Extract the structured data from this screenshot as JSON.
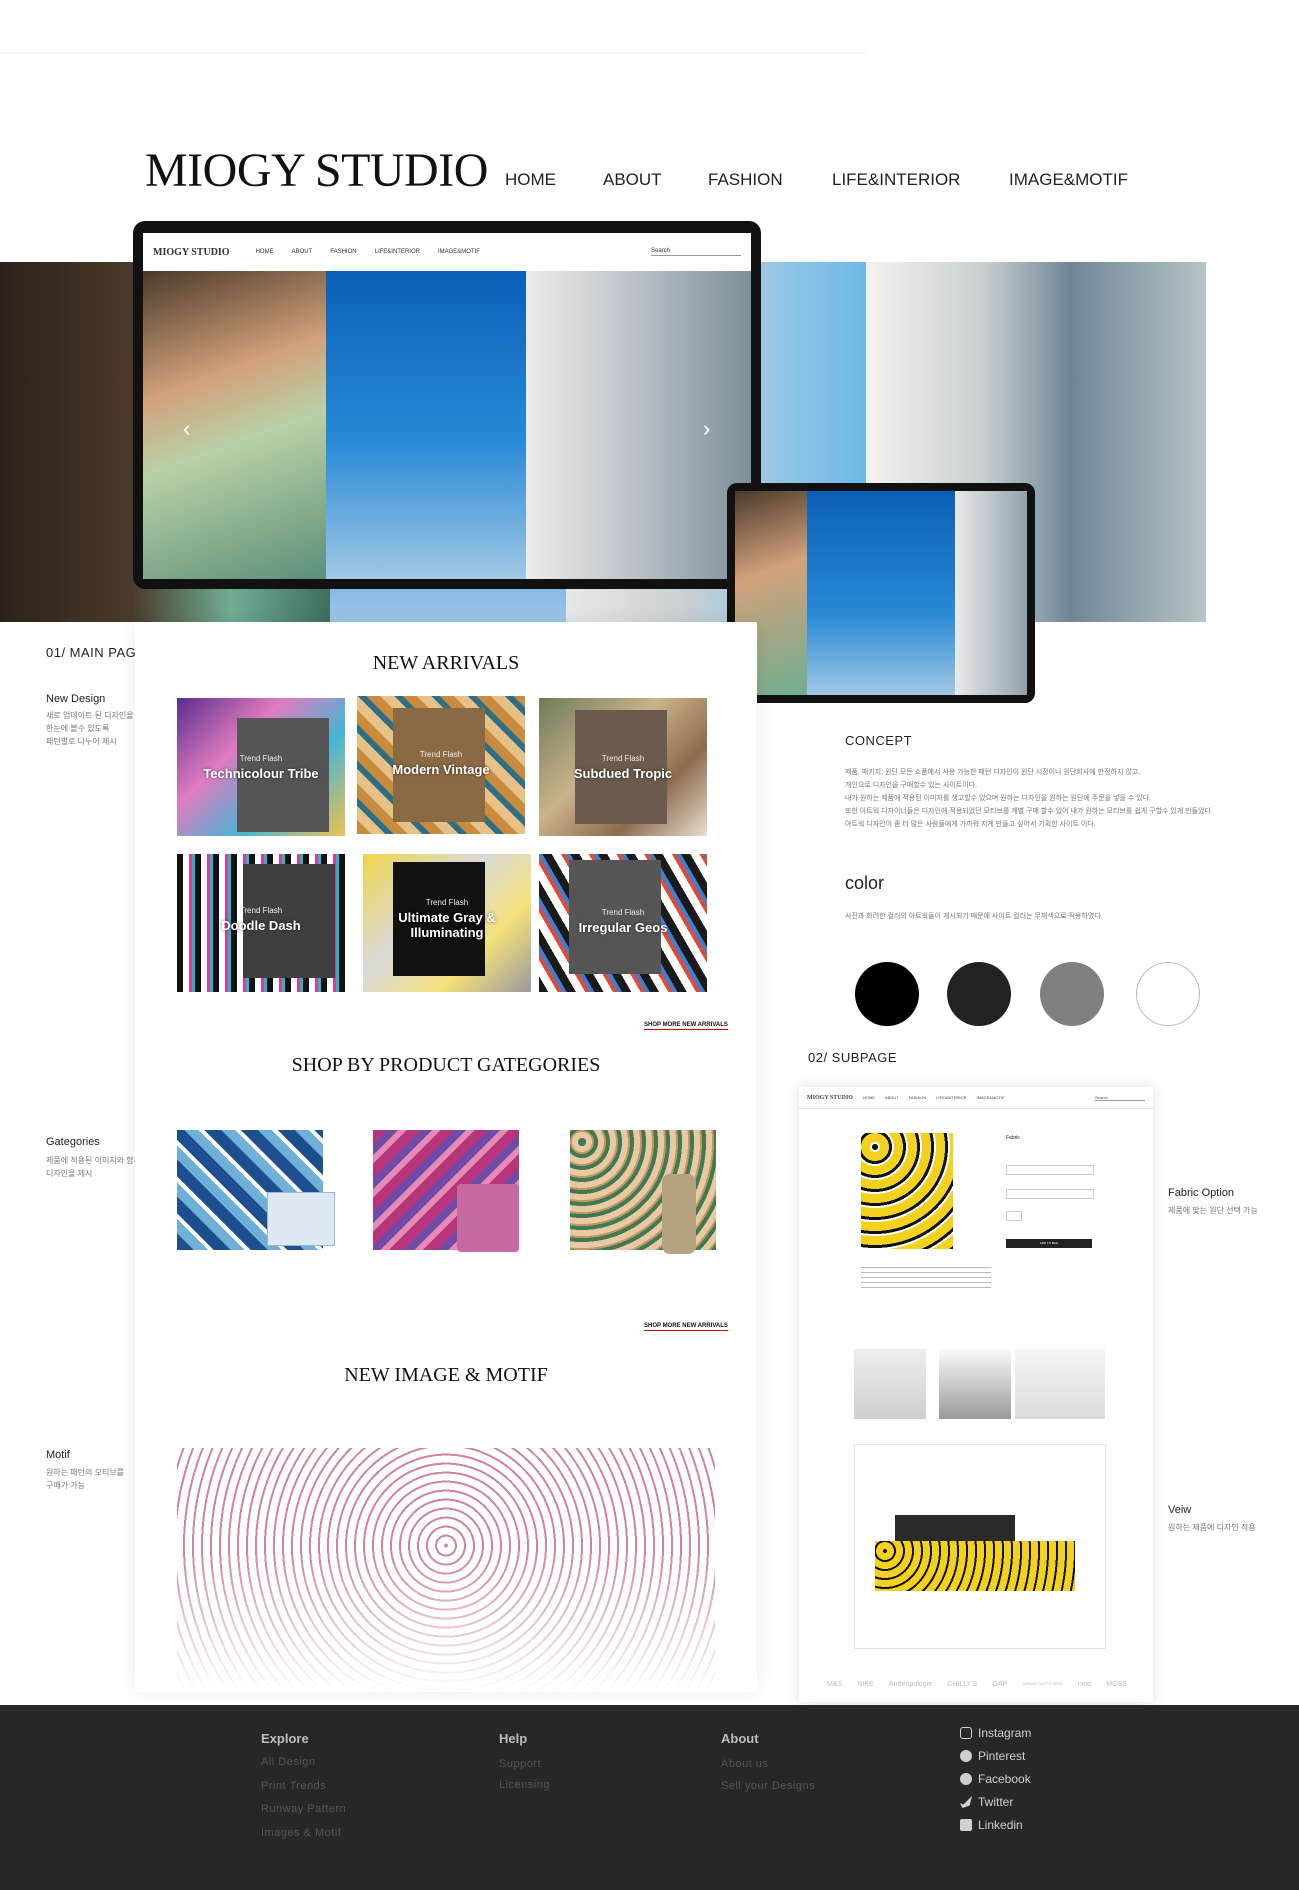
{
  "brand": "MIOGY STUDIO",
  "nav": [
    "HOME",
    "ABOUT",
    "FASHION",
    "LIFE&INTERIOR",
    "IMAGE&MOTIF"
  ],
  "mock_nav": {
    "brand": "MIOGY STUDIO",
    "items": [
      "HOME",
      "ABOUT",
      "FASHION",
      "LIFE&INTERIOR",
      "IMAGE&MOTIF"
    ],
    "search": "Search"
  },
  "left": {
    "main_label": "01/ MAIN PAGE",
    "new_design": {
      "title": "New Design",
      "lines": [
        "새로 업데이트 된 디자인을",
        "한눈에 볼수 있도록",
        "패턴별로 나누어 제시"
      ]
    },
    "categories": {
      "title": "Gategories",
      "lines": [
        "제품에 적용된 이미지와 함께",
        "디자인을 제시"
      ]
    },
    "motif": {
      "title": "Motif",
      "lines": [
        "원하는 패턴의 모티브를",
        "구매가 가능"
      ]
    }
  },
  "main": {
    "new_arrivals_title": "NEW ARRIVALS",
    "trend_flash": "Trend Flash",
    "arrivals": [
      "Technicolour Tribe",
      "Modern Vintage",
      "Subdued Tropic",
      "Doodle Dash",
      "Ultimate Gray & Illuminating",
      "Irregular Geos"
    ],
    "shop_more_1": "SHOP MORE NEW ARRIVALS",
    "categories_title": "SHOP BY PRODUCT GATEGORIES",
    "shop_more_2": "SHOP MORE NEW ARRIVALS",
    "motif_title": "NEW IMAGE & MOTIF"
  },
  "concept": {
    "title": "CONCEPT",
    "lines": [
      "제품, 패키지, 원단 모든 쇼품에서 사용 가능한 패턴 디자인이 원단 시장이나 원단회사에 한정하지 않고,",
      "개인으로 디자인을 구매할수 있는 사이트이다.",
      "내가 원하는 제품에 적용된 이미지를 생고할수 있으며 원하는 디자인을 원하는 원단에 주문을 넣을 수 있다.",
      "또한 아트웍 디자이너들은 디자인에 적용되었던 모티브를 게별 구매 할수 있어 내가 원하는 모티브를 쉽게 구할수 있게 만들었다.",
      "아트웍 디자인이 좀 더 많은 사람들에게 가까워 지게 만들고 싶어서 기획한 사이트 이다."
    ],
    "color_title": "color",
    "color_desc": "사진과 화려한 컬러의 아트웍들이 게시되기 때문에 사이트 컬러는 무채색으로 적용하였다.",
    "swatches": [
      "#000000",
      "#222222",
      "#808080",
      "#ffffff"
    ]
  },
  "right": {
    "sub_label": "02/ SUBPAGE",
    "fabric_option": {
      "title": "Fabric Option",
      "desc": "제품에 맞는 원단 선택 가능"
    },
    "view": {
      "title": "Veiw",
      "desc": "원하는 제품에 디자인 적용"
    }
  },
  "subpage": {
    "brand": "MIOGY STUDIO",
    "nav": [
      "HOME",
      "ABOUT",
      "FASHION",
      "LIFE&INTERIOR",
      "IMAGE&MOTIF"
    ],
    "search": "Search",
    "panel_title": "Fabric",
    "button": "ADD TO BAG",
    "brands": [
      "M&S",
      "NIKE",
      "Anthropologie",
      "CHILLY'S",
      "GAP",
      "URBAN OUTFITTERS",
      "next",
      "MOSS"
    ]
  },
  "footer": {
    "explore": {
      "title": "Explore",
      "links": [
        "All Design",
        "Print Trends",
        "Runway Pattern",
        "Images & Motif"
      ]
    },
    "help": {
      "title": "Help",
      "links": [
        "Support",
        "Licensing"
      ]
    },
    "about": {
      "title": "About",
      "links": [
        "About us",
        "Sell your Designs"
      ]
    },
    "social": [
      "Instagram",
      "Pinterest",
      "Facebook",
      "Twitter",
      "Linkedin"
    ]
  }
}
